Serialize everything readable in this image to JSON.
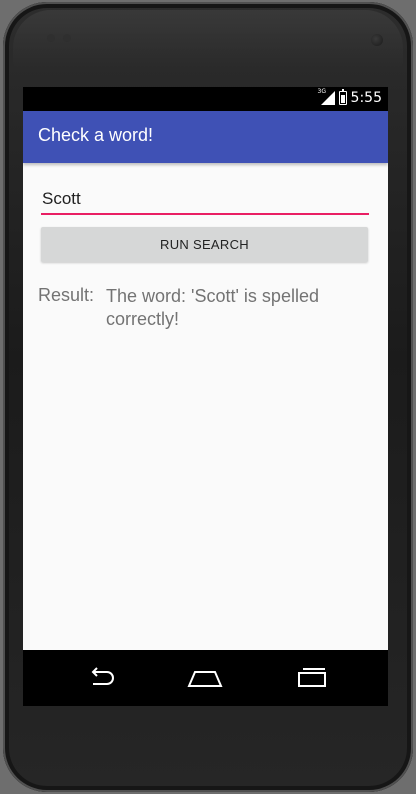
{
  "status_bar": {
    "network": "3G",
    "time": "5:55",
    "signal_icon": "signal-icon",
    "battery_icon": "battery-icon"
  },
  "app_bar": {
    "title": "Check a word!"
  },
  "search": {
    "value": "Scott",
    "button_label": "RUN SEARCH"
  },
  "result": {
    "label": "Result:",
    "text": "The word: 'Scott' is spelled correctly!"
  },
  "navigation": {
    "back_icon": "back-icon",
    "home_icon": "home-icon",
    "recents_icon": "recents-icon"
  },
  "colors": {
    "app_bar": "#3f51b5",
    "accent": "#e91e63",
    "button": "#d6d7d7"
  }
}
